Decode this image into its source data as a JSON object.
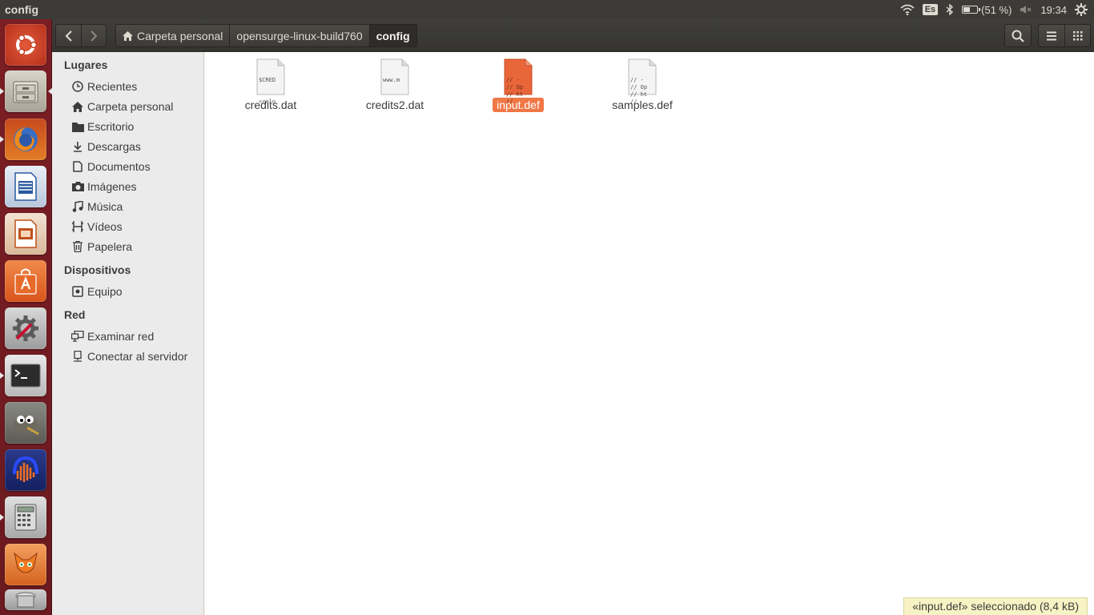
{
  "top_panel": {
    "window_title": "config",
    "keyboard_layout": "Es",
    "battery_text": "(51 %)",
    "battery_level": 0.51,
    "clock": "19:34"
  },
  "header": {
    "breadcrumbs": [
      {
        "label": "Carpeta personal",
        "icon": "home-icon"
      },
      {
        "label": "opensurge-linux-build760"
      },
      {
        "label": "config"
      }
    ]
  },
  "sidebar": {
    "sections": [
      {
        "heading": "Lugares",
        "items": [
          {
            "label": "Recientes",
            "icon": "clock-icon"
          },
          {
            "label": "Carpeta personal",
            "icon": "home-icon"
          },
          {
            "label": "Escritorio",
            "icon": "folder-icon"
          },
          {
            "label": "Descargas",
            "icon": "download-icon"
          },
          {
            "label": "Documentos",
            "icon": "document-icon"
          },
          {
            "label": "Imágenes",
            "icon": "camera-icon"
          },
          {
            "label": "Música",
            "icon": "music-icon"
          },
          {
            "label": "Vídeos",
            "icon": "film-icon"
          },
          {
            "label": "Papelera",
            "icon": "trash-icon"
          }
        ]
      },
      {
        "heading": "Dispositivos",
        "items": [
          {
            "label": "Equipo",
            "icon": "computer-icon"
          }
        ]
      },
      {
        "heading": "Red",
        "items": [
          {
            "label": "Examinar red",
            "icon": "network-icon"
          },
          {
            "label": "Conectar al servidor",
            "icon": "server-icon"
          }
        ]
      }
    ]
  },
  "files": [
    {
      "name": "credits.dat",
      "preview": [
        "$CRED",
        "",
        "",
        "<colo"
      ],
      "selected": false
    },
    {
      "name": "credits2.dat",
      "preview": [
        "www.m"
      ],
      "selected": false
    },
    {
      "name": "input.def",
      "preview": [
        "// -",
        "// Op",
        "// ht",
        "//"
      ],
      "selected": true
    },
    {
      "name": "samples.def",
      "preview": [
        "// -",
        "// Op",
        "// ht",
        "//"
      ],
      "selected": false
    }
  ],
  "status_bar": {
    "text": "«input.def» seleccionado  (8,4 kB)"
  },
  "colors": {
    "accent": "#f07746",
    "launcher": "#7b1e24",
    "panel": "#3c3b37"
  }
}
